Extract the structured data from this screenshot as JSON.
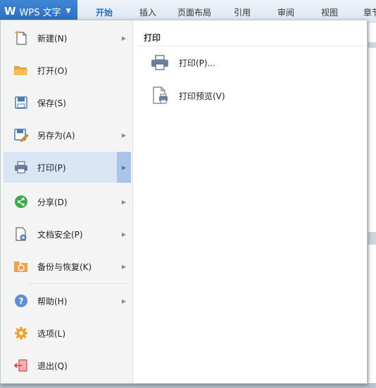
{
  "app": {
    "title": "WPS 文字"
  },
  "ribbon": {
    "tabs": [
      "开始",
      "插入",
      "页面布局",
      "引用",
      "审阅",
      "视图",
      "章节"
    ]
  },
  "menu": {
    "items": [
      {
        "label": "新建(N)",
        "icon": "new-document-icon",
        "has_submenu": true
      },
      {
        "label": "打开(O)",
        "icon": "open-folder-icon",
        "has_submenu": false
      },
      {
        "label": "保存(S)",
        "icon": "save-icon",
        "has_submenu": false
      },
      {
        "label": "另存为(A)",
        "icon": "save-as-icon",
        "has_submenu": true
      },
      {
        "label": "打印(P)",
        "icon": "printer-icon",
        "has_submenu": true,
        "active": true
      },
      {
        "label": "分享(D)",
        "icon": "share-icon",
        "has_submenu": true
      },
      {
        "label": "文档安全(P)",
        "icon": "document-security-icon",
        "has_submenu": true
      },
      {
        "label": "备份与恢复(K)",
        "icon": "backup-restore-icon",
        "has_submenu": true
      },
      {
        "label": "帮助(H)",
        "icon": "help-icon",
        "has_submenu": true
      },
      {
        "label": "选项(L)",
        "icon": "gear-icon",
        "has_submenu": false
      },
      {
        "label": "退出(Q)",
        "icon": "exit-icon",
        "has_submenu": false
      }
    ]
  },
  "submenu": {
    "title": "打印",
    "items": [
      {
        "label": "打印(P)...",
        "icon": "printer-icon"
      },
      {
        "label": "打印预览(V)",
        "icon": "print-preview-icon"
      }
    ]
  },
  "colors": {
    "accent": "#2a6cbf",
    "active_item_bg": "#d9e6f6",
    "active_arrow_bg": "#a9c4e6"
  }
}
